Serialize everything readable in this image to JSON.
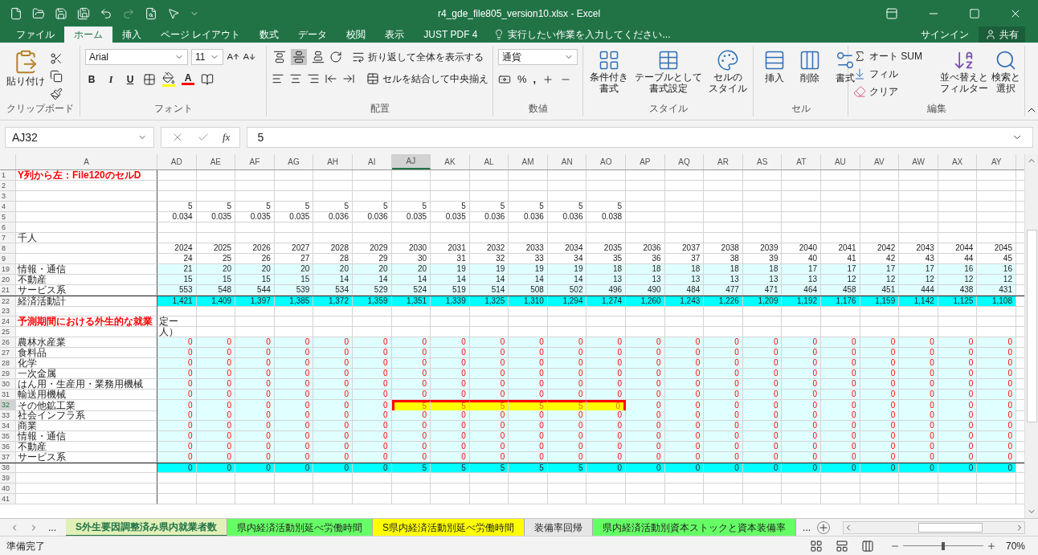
{
  "window": {
    "title": "r4_gde_file805_version10.xlsx - Excel"
  },
  "menu_tabs": [
    {
      "label": "ファイル",
      "selected": false
    },
    {
      "label": "ホーム",
      "selected": true
    },
    {
      "label": "挿入",
      "selected": false
    },
    {
      "label": "ページ レイアウト",
      "selected": false
    },
    {
      "label": "数式",
      "selected": false
    },
    {
      "label": "データ",
      "selected": false
    },
    {
      "label": "校閲",
      "selected": false
    },
    {
      "label": "表示",
      "selected": false
    },
    {
      "label": "JUST PDF 4",
      "selected": false
    }
  ],
  "tell_me": "実行したい作業を入力してください...",
  "sign_in": "サインイン",
  "share": "共有",
  "ribbon": {
    "clipboard": {
      "paste": "貼り付け",
      "label": "クリップボード"
    },
    "font": {
      "name": "Arial",
      "size": "11",
      "styles": [
        "B",
        "I",
        "U"
      ],
      "color_letter": "A",
      "label": "フォント"
    },
    "alignment": {
      "vertical": [
        {
          "selected": false
        },
        {
          "selected": true
        },
        {
          "selected": false
        }
      ],
      "wrap": "折り返して全体を表示する",
      "merge": "セルを結合して中央揃え",
      "label": "配置"
    },
    "number": {
      "format": "通貨",
      "percent": "%",
      "comma": ",",
      "label": "数値"
    },
    "styles": {
      "buttons": [
        [
          "条件付き",
          "書式"
        ],
        [
          "テーブルとして",
          "書式設定"
        ],
        [
          "セルの",
          "スタイル"
        ]
      ],
      "label": "スタイル"
    },
    "cells": {
      "buttons": [
        "挿入",
        "削除",
        "書式"
      ],
      "label": "セル"
    },
    "editing": {
      "autosum": "オート SUM",
      "fill": "フィル",
      "clear": "クリア",
      "sort": [
        "並べ替えと",
        "フィルター"
      ],
      "find": [
        "検索と",
        "選択"
      ],
      "label": "編集"
    }
  },
  "formula_bar": {
    "name_box": "AJ32",
    "fx": "fx",
    "value": "5"
  },
  "columns": [
    {
      "label": "AD",
      "selected": false
    },
    {
      "label": "AE",
      "selected": false
    },
    {
      "label": "AF",
      "selected": false
    },
    {
      "label": "AG",
      "selected": false
    },
    {
      "label": "AH",
      "selected": false
    },
    {
      "label": "AI",
      "selected": false
    },
    {
      "label": "AJ",
      "selected": true
    },
    {
      "label": "AK",
      "selected": false
    },
    {
      "label": "AL",
      "selected": false
    },
    {
      "label": "AM",
      "selected": false
    },
    {
      "label": "AN",
      "selected": false
    },
    {
      "label": "AO",
      "selected": false
    },
    {
      "label": "AP",
      "selected": false
    },
    {
      "label": "AQ",
      "selected": false
    },
    {
      "label": "AR",
      "selected": false
    },
    {
      "label": "AS",
      "selected": false
    },
    {
      "label": "AT",
      "selected": false
    },
    {
      "label": "AU",
      "selected": false
    },
    {
      "label": "AV",
      "selected": false
    },
    {
      "label": "AW",
      "selected": false
    },
    {
      "label": "AX",
      "selected": false
    },
    {
      "label": "AY",
      "selected": false
    }
  ],
  "column_a": "A",
  "rows": [
    {
      "num": "1",
      "selected": false,
      "kind": "plain",
      "label": "Y列から左：File120のセルD",
      "color": "#ff0000",
      "cells": []
    },
    {
      "num": "2",
      "selected": false,
      "kind": "plain",
      "cells": []
    },
    {
      "num": "3",
      "selected": false,
      "kind": "plain",
      "cells": []
    },
    {
      "num": "4",
      "selected": false,
      "kind": "plain",
      "cells": [
        "5",
        "5",
        "5",
        "5",
        "5",
        "5",
        "5",
        "5",
        "5",
        "5",
        "5",
        "5"
      ]
    },
    {
      "num": "5",
      "selected": false,
      "kind": "plain",
      "cells": [
        "0.034",
        "0.035",
        "0.035",
        "0.035",
        "0.036",
        "0.036",
        "0.035",
        "0.035",
        "0.036",
        "0.036",
        "0.036",
        "0.038"
      ]
    },
    {
      "num": "6",
      "selected": false,
      "kind": "plain",
      "cells": []
    },
    {
      "num": "7",
      "selected": false,
      "kind": "plain",
      "label": "千人",
      "cells": []
    },
    {
      "num": "8",
      "selected": false,
      "kind": "plain",
      "cells": [
        "2024",
        "2025",
        "2026",
        "2027",
        "2028",
        "2029",
        "2030",
        "2031",
        "2032",
        "2033",
        "2034",
        "2035",
        "2036",
        "2037",
        "2038",
        "2039",
        "2040",
        "2041",
        "2042",
        "2043",
        "2044",
        "2045"
      ]
    },
    {
      "num": "9",
      "selected": false,
      "kind": "plain",
      "cells": [
        "24",
        "25",
        "26",
        "27",
        "28",
        "29",
        "30",
        "31",
        "32",
        "33",
        "34",
        "35",
        "36",
        "37",
        "38",
        "39",
        "40",
        "41",
        "42",
        "43",
        "44",
        "45"
      ]
    },
    {
      "num": "19",
      "selected": false,
      "kind": "band",
      "label": "情報・通信",
      "cells": [
        "21",
        "20",
        "20",
        "20",
        "20",
        "20",
        "20",
        "19",
        "19",
        "19",
        "19",
        "18",
        "18",
        "18",
        "18",
        "18",
        "17",
        "17",
        "17",
        "17",
        "16",
        "16"
      ]
    },
    {
      "num": "20",
      "selected": false,
      "kind": "band",
      "label": "不動産",
      "cells": [
        "15",
        "15",
        "15",
        "15",
        "14",
        "14",
        "14",
        "14",
        "14",
        "14",
        "14",
        "13",
        "13",
        "13",
        "13",
        "13",
        "13",
        "12",
        "12",
        "12",
        "12",
        "12"
      ]
    },
    {
      "num": "21",
      "selected": false,
      "kind": "band",
      "label": "サービス系",
      "cells": [
        "553",
        "548",
        "544",
        "539",
        "534",
        "529",
        "524",
        "519",
        "514",
        "508",
        "502",
        "496",
        "490",
        "484",
        "477",
        "471",
        "464",
        "458",
        "451",
        "444",
        "438",
        "431"
      ]
    },
    {
      "num": "22",
      "selected": false,
      "kind": "total",
      "label": "経済活動計",
      "cells": [
        "1,421",
        "1,409",
        "1,397",
        "1,385",
        "1,372",
        "1,359",
        "1,351",
        "1,339",
        "1,325",
        "1,310",
        "1,294",
        "1,274",
        "1,260",
        "1,243",
        "1,226",
        "1,209",
        "1,192",
        "1,176",
        "1,159",
        "1,142",
        "1,125",
        "1,108"
      ]
    },
    {
      "num": "23",
      "selected": false,
      "kind": "plain",
      "cells": []
    },
    {
      "num": "24",
      "selected": false,
      "kind": "note",
      "label": "予測期間における外生的な就業",
      "color": "#ff0000",
      "cells": [
        "定ー"
      ]
    },
    {
      "num": "25",
      "selected": false,
      "kind": "note",
      "cells": [
        "人）"
      ]
    },
    {
      "num": "26",
      "selected": false,
      "kind": "input",
      "label": "農林水産業",
      "cells": [
        "0",
        "0",
        "0",
        "0",
        "0",
        "0",
        "0",
        "0",
        "0",
        "0",
        "0",
        "0",
        "0",
        "0",
        "0",
        "0",
        "0",
        "0",
        "0",
        "0",
        "0",
        "0"
      ]
    },
    {
      "num": "27",
      "selected": false,
      "kind": "input",
      "label": "食料品",
      "cells": [
        "0",
        "0",
        "0",
        "0",
        "0",
        "0",
        "0",
        "0",
        "0",
        "0",
        "0",
        "0",
        "0",
        "0",
        "0",
        "0",
        "0",
        "0",
        "0",
        "0",
        "0",
        "0"
      ]
    },
    {
      "num": "28",
      "selected": false,
      "kind": "input",
      "label": "化学",
      "cells": [
        "0",
        "0",
        "0",
        "0",
        "0",
        "0",
        "0",
        "0",
        "0",
        "0",
        "0",
        "0",
        "0",
        "0",
        "0",
        "0",
        "0",
        "0",
        "0",
        "0",
        "0",
        "0"
      ]
    },
    {
      "num": "29",
      "selected": false,
      "kind": "input",
      "label": "一次金属",
      "cells": [
        "0",
        "0",
        "0",
        "0",
        "0",
        "0",
        "0",
        "0",
        "0",
        "0",
        "0",
        "0",
        "0",
        "0",
        "0",
        "0",
        "0",
        "0",
        "0",
        "0",
        "0",
        "0"
      ]
    },
    {
      "num": "30",
      "selected": false,
      "kind": "input",
      "label": "はん用・生産用・業務用機械",
      "cells": [
        "0",
        "0",
        "0",
        "0",
        "0",
        "0",
        "0",
        "0",
        "0",
        "0",
        "0",
        "0",
        "0",
        "0",
        "0",
        "0",
        "0",
        "0",
        "0",
        "0",
        "0",
        "0"
      ]
    },
    {
      "num": "31",
      "selected": false,
      "kind": "input",
      "label": "輸送用機械",
      "cells": [
        "0",
        "0",
        "0",
        "0",
        "0",
        "0",
        "0",
        "0",
        "0",
        "0",
        "0",
        "0",
        "0",
        "0",
        "0",
        "0",
        "0",
        "0",
        "0",
        "0",
        "0",
        "0"
      ]
    },
    {
      "num": "32",
      "selected": true,
      "kind": "input",
      "label": "その他鉱工業",
      "cells": [
        {
          "text": "0",
          "highlighted": false
        },
        {
          "text": "0",
          "highlighted": false
        },
        {
          "text": "0",
          "highlighted": false
        },
        {
          "text": "0",
          "highlighted": false
        },
        {
          "text": "0",
          "highlighted": false
        },
        {
          "text": "0",
          "highlighted": false
        },
        {
          "text": "5",
          "highlighted": true
        },
        {
          "text": "5",
          "highlighted": true
        },
        {
          "text": "5",
          "highlighted": true
        },
        {
          "text": "5",
          "highlighted": true
        },
        {
          "text": "5",
          "highlighted": true
        },
        {
          "text": "0",
          "highlighted": true
        },
        {
          "text": "0",
          "highlighted": false
        },
        {
          "text": "0",
          "highlighted": false
        },
        {
          "text": "0",
          "highlighted": false
        },
        {
          "text": "0",
          "highlighted": false
        },
        {
          "text": "0",
          "highlighted": false
        },
        {
          "text": "0",
          "highlighted": false
        },
        {
          "text": "0",
          "highlighted": false
        },
        {
          "text": "0",
          "highlighted": false
        },
        {
          "text": "0",
          "highlighted": false
        },
        {
          "text": "0",
          "highlighted": false
        }
      ]
    },
    {
      "num": "33",
      "selected": false,
      "kind": "input",
      "label": "社会インフラ系",
      "cells": [
        "0",
        "0",
        "0",
        "0",
        "0",
        "0",
        "0",
        "0",
        "0",
        "0",
        "0",
        "0",
        "0",
        "0",
        "0",
        "0",
        "0",
        "0",
        "0",
        "0",
        "0",
        "0"
      ]
    },
    {
      "num": "34",
      "selected": false,
      "kind": "input",
      "label": "商業",
      "cells": [
        "0",
        "0",
        "0",
        "0",
        "0",
        "0",
        "0",
        "0",
        "0",
        "0",
        "0",
        "0",
        "0",
        "0",
        "0",
        "0",
        "0",
        "0",
        "0",
        "0",
        "0",
        "0"
      ]
    },
    {
      "num": "35",
      "selected": false,
      "kind": "input",
      "label": "情報・通信",
      "cells": [
        "0",
        "0",
        "0",
        "0",
        "0",
        "0",
        "0",
        "0",
        "0",
        "0",
        "0",
        "0",
        "0",
        "0",
        "0",
        "0",
        "0",
        "0",
        "0",
        "0",
        "0",
        "0"
      ]
    },
    {
      "num": "36",
      "selected": false,
      "kind": "input",
      "label": "不動産",
      "cells": [
        "0",
        "0",
        "0",
        "0",
        "0",
        "0",
        "0",
        "0",
        "0",
        "0",
        "0",
        "0",
        "0",
        "0",
        "0",
        "0",
        "0",
        "0",
        "0",
        "0",
        "0",
        "0"
      ]
    },
    {
      "num": "37",
      "selected": false,
      "kind": "input",
      "label": "サービス系",
      "cells": [
        "0",
        "0",
        "0",
        "0",
        "0",
        "0",
        "0",
        "0",
        "0",
        "0",
        "0",
        "0",
        "0",
        "0",
        "0",
        "0",
        "0",
        "0",
        "0",
        "0",
        "0",
        "0"
      ]
    },
    {
      "num": "38",
      "selected": false,
      "kind": "total",
      "cells": [
        "0",
        "0",
        "0",
        "0",
        "0",
        "0",
        "5",
        "5",
        "5",
        "5",
        "5",
        "0",
        "0",
        "0",
        "0",
        "0",
        "0",
        "0",
        "0",
        "0",
        "0",
        "0"
      ]
    },
    {
      "num": "39",
      "selected": false,
      "kind": "plain",
      "cells": []
    },
    {
      "num": "40",
      "selected": false,
      "kind": "plain",
      "cells": []
    },
    {
      "num": "41",
      "selected": false,
      "kind": "plain",
      "cells": []
    }
  ],
  "sheet_tabs": {
    "more_left": "...",
    "tabs": [
      {
        "label": "S外生要因調整済み県内就業者数",
        "selected": true,
        "color": "#e2f0b8"
      },
      {
        "label": "県内経済活動別延べ労働時間",
        "selected": false,
        "color": "#66ff66"
      },
      {
        "label": "S県内経済活動別延べ労働時間",
        "selected": false,
        "color": "#ffff00"
      },
      {
        "label": "装備率回帰",
        "selected": false,
        "color": "#e6e6e6"
      },
      {
        "label": "県内経済活動別資本ストックと資本装備率",
        "selected": false,
        "color": "#66ff66"
      }
    ],
    "more_right": "..."
  },
  "status_bar": {
    "status": "準備完了",
    "zoom": {
      "level": 0.5,
      "reading": "70%"
    }
  }
}
